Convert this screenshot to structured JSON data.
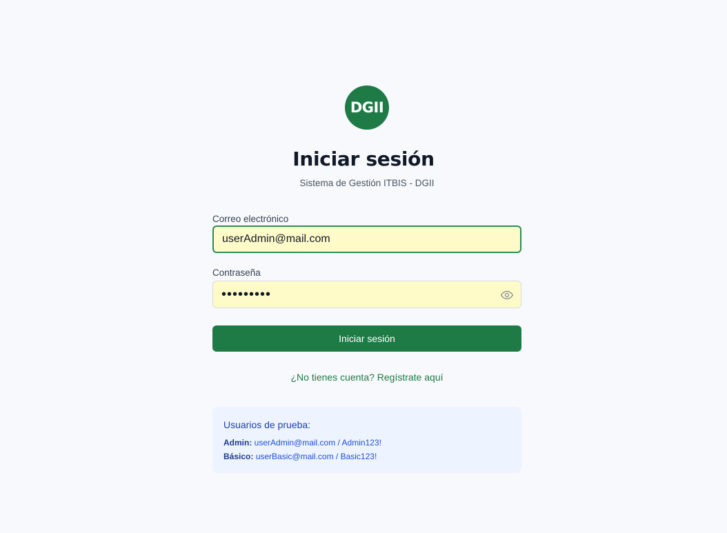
{
  "logo": {
    "text": "DGII",
    "color": "#1e7b45"
  },
  "header": {
    "title": "Iniciar sesión",
    "subtitle": "Sistema de Gestión ITBIS - DGII"
  },
  "form": {
    "email_label": "Correo electrónico",
    "email_value": "userAdmin@mail.com",
    "password_label": "Contraseña",
    "password_value": "admin1234",
    "password_toggle_icon": "eye-icon",
    "submit_label": "Iniciar sesión",
    "accent_color": "#1e7b45",
    "input_background": "#fefbc8"
  },
  "register_link": "¿No tienes cuenta? Regístrate aquí",
  "test_users": {
    "title": "Usuarios de prueba:",
    "admin_label": "Admin:",
    "admin_credentials": "userAdmin@mail.com / Admin123!",
    "basic_label": "Básico:",
    "basic_credentials": "userBasic@mail.com / Basic123!",
    "background": "#eef4ff"
  }
}
